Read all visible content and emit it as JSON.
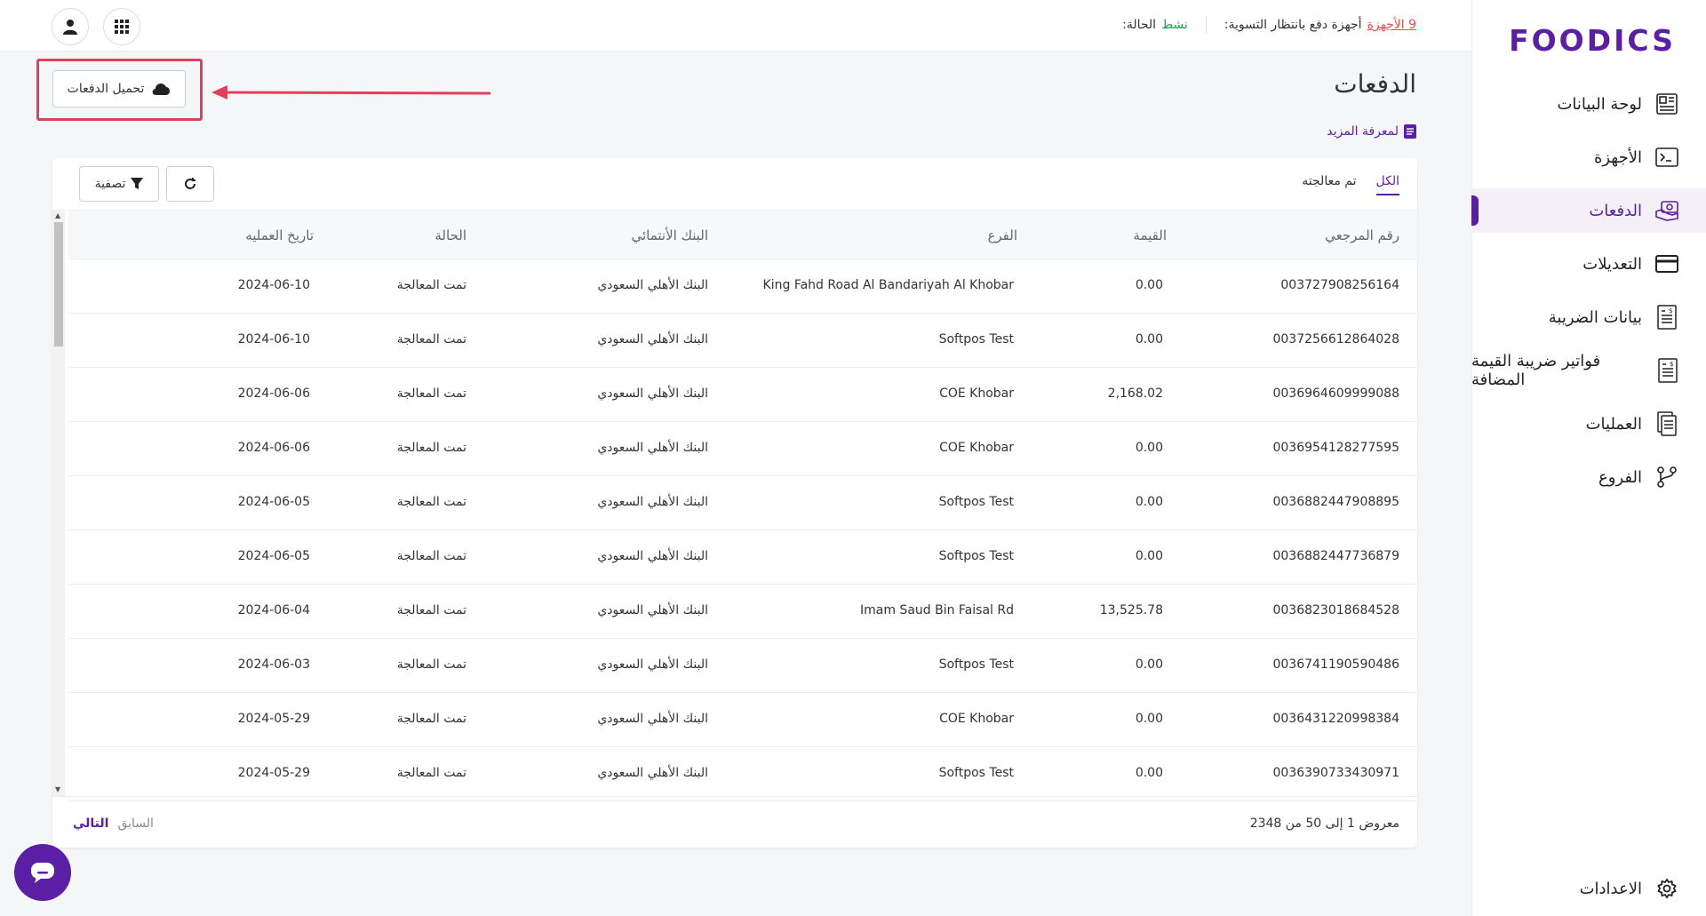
{
  "brand": {
    "logo_text": "FOODICS",
    "accent": "#5b1fa6"
  },
  "topbar": {
    "status_label": "الحالة:",
    "status_value": "نشط",
    "pending_label": "أجهزة دفع بانتظار التسوية:",
    "pending_value": "9 الأجهزة"
  },
  "sidebar": {
    "items": [
      {
        "label": "لوحة البيانات",
        "icon": "dashboard-icon"
      },
      {
        "label": "الأجهزة",
        "icon": "terminal-icon"
      },
      {
        "label": "الدفعات",
        "icon": "payments-icon"
      },
      {
        "label": "التعديلات",
        "icon": "card-icon"
      },
      {
        "label": "بيانات الضريبة",
        "icon": "tax-doc-icon"
      },
      {
        "label": "فواتير ضريبة القيمة المضافة",
        "icon": "invoice-icon"
      },
      {
        "label": "العمليات",
        "icon": "transactions-icon"
      },
      {
        "label": "الفروع",
        "icon": "branches-icon"
      }
    ],
    "settings_label": "الاعدادات"
  },
  "page": {
    "title": "الدفعات",
    "learn_more": "لمعرفة المزيد",
    "download_label": "تحميل الدفعات"
  },
  "tabs": [
    {
      "label": "الكل"
    },
    {
      "label": "تم معالجته"
    }
  ],
  "toolbar": {
    "filter_label": "تصفية"
  },
  "table": {
    "columns": [
      "رقم المرجعي",
      "القيمة",
      "الفرع",
      "البنك الأنتمائي",
      "الحالة",
      "تاريخ العمليه"
    ],
    "rows": [
      [
        "003727908256164",
        "0.00",
        "King Fahd Road Al Bandariyah Al Khobar",
        "البنك الأهلي السعودي",
        "تمت المعالجة",
        "2024-06-10"
      ],
      [
        "0037256612864028",
        "0.00",
        "Softpos Test",
        "البنك الأهلي السعودي",
        "تمت المعالجة",
        "2024-06-10"
      ],
      [
        "0036964609999088",
        "2,168.02",
        "COE Khobar",
        "البنك الأهلي السعودي",
        "تمت المعالجة",
        "2024-06-06"
      ],
      [
        "0036954128277595",
        "0.00",
        "COE Khobar",
        "البنك الأهلي السعودي",
        "تمت المعالجة",
        "2024-06-06"
      ],
      [
        "0036882447908895",
        "0.00",
        "Softpos Test",
        "البنك الأهلي السعودي",
        "تمت المعالجة",
        "2024-06-05"
      ],
      [
        "0036882447736879",
        "0.00",
        "Softpos Test",
        "البنك الأهلي السعودي",
        "تمت المعالجة",
        "2024-06-05"
      ],
      [
        "0036823018684528",
        "13,525.78",
        "Imam Saud Bin Faisal Rd",
        "البنك الأهلي السعودي",
        "تمت المعالجة",
        "2024-06-04"
      ],
      [
        "0036741190590486",
        "0.00",
        "Softpos Test",
        "البنك الأهلي السعودي",
        "تمت المعالجة",
        "2024-06-03"
      ],
      [
        "0036431220998384",
        "0.00",
        "COE Khobar",
        "البنك الأهلي السعودي",
        "تمت المعالجة",
        "2024-05-29"
      ],
      [
        "0036390733430971",
        "0.00",
        "Softpos Test",
        "البنك الأهلي السعودي",
        "تمت المعالجة",
        "2024-05-29"
      ]
    ]
  },
  "pagination": {
    "summary": "معروض 1 إلى 50 من 2348",
    "prev_label": "السابق",
    "next_label": "التالي"
  }
}
